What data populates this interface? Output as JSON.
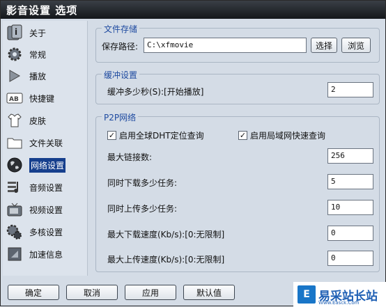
{
  "window": {
    "title": "影音设置 选项"
  },
  "sidebar": {
    "items": [
      {
        "label": "关于",
        "icon": "info-icon"
      },
      {
        "label": "常规",
        "icon": "gear-icon"
      },
      {
        "label": "播放",
        "icon": "play-icon"
      },
      {
        "label": "快捷键",
        "icon": "keyboard-icon"
      },
      {
        "label": "皮肤",
        "icon": "shirt-icon"
      },
      {
        "label": "文件关联",
        "icon": "folder-icon"
      },
      {
        "label": "网络设置",
        "icon": "globe-icon"
      },
      {
        "label": "音频设置",
        "icon": "audio-icon"
      },
      {
        "label": "视频设置",
        "icon": "tv-icon"
      },
      {
        "label": "多核设置",
        "icon": "cpu-gear-icon"
      },
      {
        "label": "加速信息",
        "icon": "rocket-icon"
      }
    ],
    "active_index": 6
  },
  "storage": {
    "title": "文件存储",
    "path_label": "保存路径:",
    "path_value": "C:\\xfmovie",
    "choose_button": "选择",
    "browse_button": "浏览"
  },
  "buffer": {
    "title": "缓冲设置",
    "seconds_label": "缓冲多少秒(S):[开始播放]",
    "seconds_value": "2"
  },
  "p2p": {
    "title": "P2P网络",
    "dht_label": "启用全球DHT定位查询",
    "dht_checked": true,
    "lan_label": "启用局域网快速查询",
    "lan_checked": true,
    "max_conn_label": "最大链接数:",
    "max_conn_value": "256",
    "dl_tasks_label": "同时下载多少任务:",
    "dl_tasks_value": "5",
    "ul_tasks_label": "同时上传多少任务:",
    "ul_tasks_value": "10",
    "max_dl_label": "最大下载速度(Kb/s):[0:无限制]",
    "max_dl_value": "0",
    "max_ul_label": "最大上传速度(Kb/s):[0:无限制]",
    "max_ul_value": "0"
  },
  "footer": {
    "ok": "确定",
    "cancel": "取消",
    "apply": "应用",
    "default": "默认值"
  },
  "watermark": {
    "logo": "E",
    "text": "易采站长站",
    "sub": "Www.Easck.Com"
  }
}
